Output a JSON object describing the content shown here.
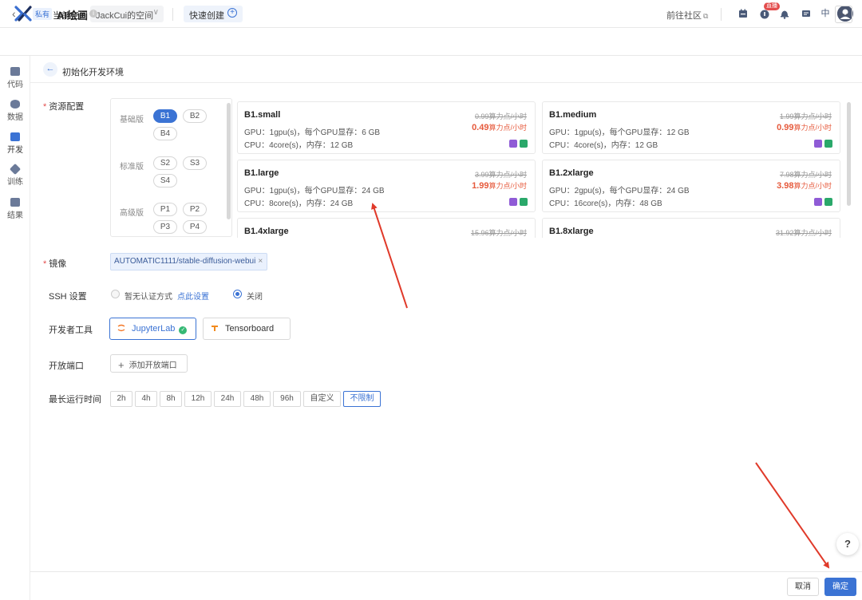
{
  "header": {
    "current_space_label": "当前空间",
    "space_name": "JackCui的空间",
    "quick_create_label": "快速创建",
    "community_label": "前往社区",
    "live_badge": "直播",
    "lang_label": "中",
    "icons": [
      "calendar-icon",
      "live-icon",
      "bell-icon",
      "message-icon",
      "language-icon",
      "user-avatar-icon"
    ]
  },
  "project": {
    "visibility_tag": "私有",
    "title": "AI绘画"
  },
  "sidebar": {
    "items": [
      {
        "label": "代码",
        "icon": "code-icon"
      },
      {
        "label": "数据",
        "icon": "database-icon"
      },
      {
        "label": "开发",
        "icon": "dev-icon",
        "active": true
      },
      {
        "label": "训练",
        "icon": "train-icon"
      },
      {
        "label": "结果",
        "icon": "folder-icon"
      }
    ]
  },
  "page": {
    "title": "初始化开发环境"
  },
  "resource": {
    "label": "资源配置",
    "tiers": [
      {
        "label": "基础版",
        "specs": [
          "B1",
          "B2",
          "B4"
        ],
        "selected": "B1"
      },
      {
        "label": "标准版",
        "specs": [
          "S2",
          "S3",
          "S4"
        ]
      },
      {
        "label": "高级版",
        "specs": [
          "P1",
          "P2",
          "P3",
          "P4"
        ]
      }
    ],
    "cards": [
      {
        "name": "B1.small",
        "gpu": "GPU：1gpu(s)，每个GPU显存：6 GB",
        "cpu": "CPU：4core(s)，内存：12 GB",
        "old_price": "0.99算力点/小时",
        "price": "0.49",
        "price_unit": "算力点/小时"
      },
      {
        "name": "B1.medium",
        "gpu": "GPU：1gpu(s)，每个GPU显存：12 GB",
        "cpu": "CPU：4core(s)，内存：12 GB",
        "old_price": "1.99算力点/小时",
        "price": "0.99",
        "price_unit": "算力点/小时"
      },
      {
        "name": "B1.large",
        "gpu": "GPU：1gpu(s)，每个GPU显存：24 GB",
        "cpu": "CPU：8core(s)，内存：24 GB",
        "old_price": "3.99算力点/小时",
        "price": "1.99",
        "price_unit": "算力点/小时"
      },
      {
        "name": "B1.2xlarge",
        "gpu": "GPU：2gpu(s)，每个GPU显存：24 GB",
        "cpu": "CPU：16core(s)，内存：48 GB",
        "old_price": "7.98算力点/小时",
        "price": "3.98",
        "price_unit": "算力点/小时"
      },
      {
        "name": "B1.4xlarge",
        "gpu": "",
        "cpu": "",
        "old_price": "15.96算力点/小时",
        "price": "",
        "price_unit": ""
      },
      {
        "name": "B1.8xlarge",
        "gpu": "",
        "cpu": "",
        "old_price": "31.92算力点/小时",
        "price": "",
        "price_unit": ""
      }
    ]
  },
  "image": {
    "label": "镜像",
    "value": "AUTOMATIC1111/stable-diffusion-webui",
    "remove": "×"
  },
  "ssh": {
    "label": "SSH 设置",
    "option_none": "暂无认证方式",
    "setup_link": "点此设置",
    "option_off": "关闭",
    "selected": "关闭"
  },
  "dev_tools": {
    "label": "开发者工具",
    "items": [
      {
        "label": "JupyterLab",
        "selected": true
      },
      {
        "label": "Tensorboard",
        "selected": false
      }
    ]
  },
  "ports": {
    "label": "开放端口",
    "add_label": "添加开放端口"
  },
  "runtime": {
    "label": "最长运行时间",
    "options": [
      "2h",
      "4h",
      "8h",
      "12h",
      "24h",
      "48h",
      "96h",
      "自定义",
      "不限制"
    ],
    "selected": "不限制"
  },
  "footer": {
    "cancel_label": "取消",
    "confirm_label": "确定"
  },
  "help_label": "?",
  "colors": {
    "primary": "#3b73d4",
    "price": "#e65a3c",
    "annotation_arrow": "#e03a2a"
  }
}
